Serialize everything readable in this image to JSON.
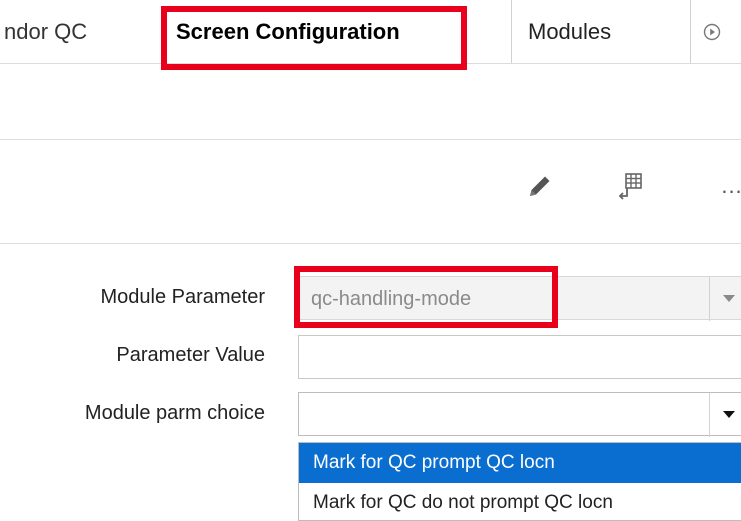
{
  "tabs": {
    "vendor_qc": "ndor QC",
    "screen_configuration": "Screen Configuration",
    "modules": "Modules"
  },
  "toolbar": {
    "more_label": "..."
  },
  "form": {
    "module_parameter": {
      "label": "Module Parameter",
      "value": "qc-handling-mode"
    },
    "parameter_value": {
      "label": "Parameter Value",
      "value": ""
    },
    "module_parm_choice": {
      "label": "Module parm choice",
      "value": "",
      "options": [
        "Mark for QC prompt QC locn",
        "Mark for QC do not prompt QC locn"
      ],
      "highlighted_option": "Mark for QC prompt QC locn"
    }
  },
  "colors": {
    "highlight_frame": "#e8001c",
    "selection_blue": "#0a6ed1"
  },
  "icons": {
    "tab_more": "play-circle-icon",
    "edit": "pencil-icon",
    "grid": "table-export-icon"
  }
}
